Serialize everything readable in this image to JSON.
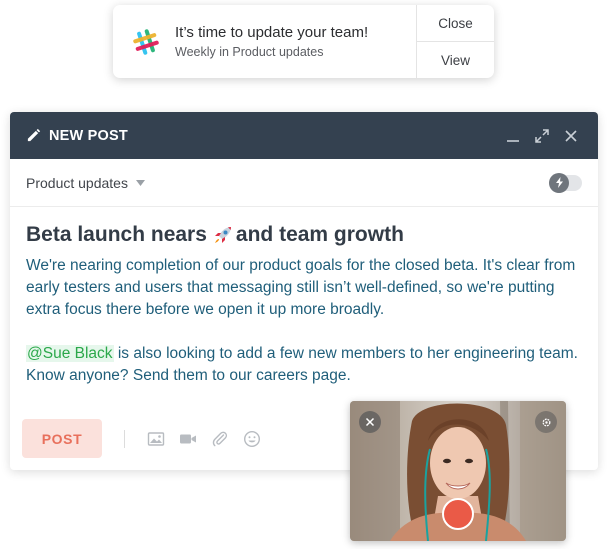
{
  "notification": {
    "title": "It’s time to update your team!",
    "subtitle": "Weekly in Product updates",
    "close_label": "Close",
    "view_label": "View",
    "icon": "slack-logo"
  },
  "composer": {
    "header_title": "NEW POST",
    "header_icon": "pencil-icon",
    "window_controls": [
      "minimize-icon",
      "expand-icon",
      "close-icon"
    ],
    "channel_selected": "Product updates",
    "toggle_state": "off",
    "post_title_before": "Beta launch nears ",
    "post_title_emoji": "rocket",
    "post_title_after": "and team growth",
    "paragraph_1": "We're nearing completion of our product goals for the closed beta. It's clear from early testers and users that messaging still isn’t well-defined, so we're putting extra focus there before we open it up more broadly.",
    "mention": "@Sue Black",
    "paragraph_2_rest": " is also looking to add a few new members to her engineering team. Know anyone? Send them to our careers page.",
    "post_button_label": "POST",
    "footer_tools": [
      "image-icon",
      "video-icon",
      "attachment-icon",
      "emoji-icon"
    ]
  },
  "camera_preview": {
    "controls": [
      "close-icon",
      "gear-icon",
      "record-button"
    ]
  },
  "colors": {
    "header_bg": "#344150",
    "mention_green": "#2ba84a",
    "body_text": "#1f5e7a",
    "post_button_bg": "#fbe1dc",
    "post_button_text": "#e8705c",
    "record_red": "#ea5a47"
  }
}
